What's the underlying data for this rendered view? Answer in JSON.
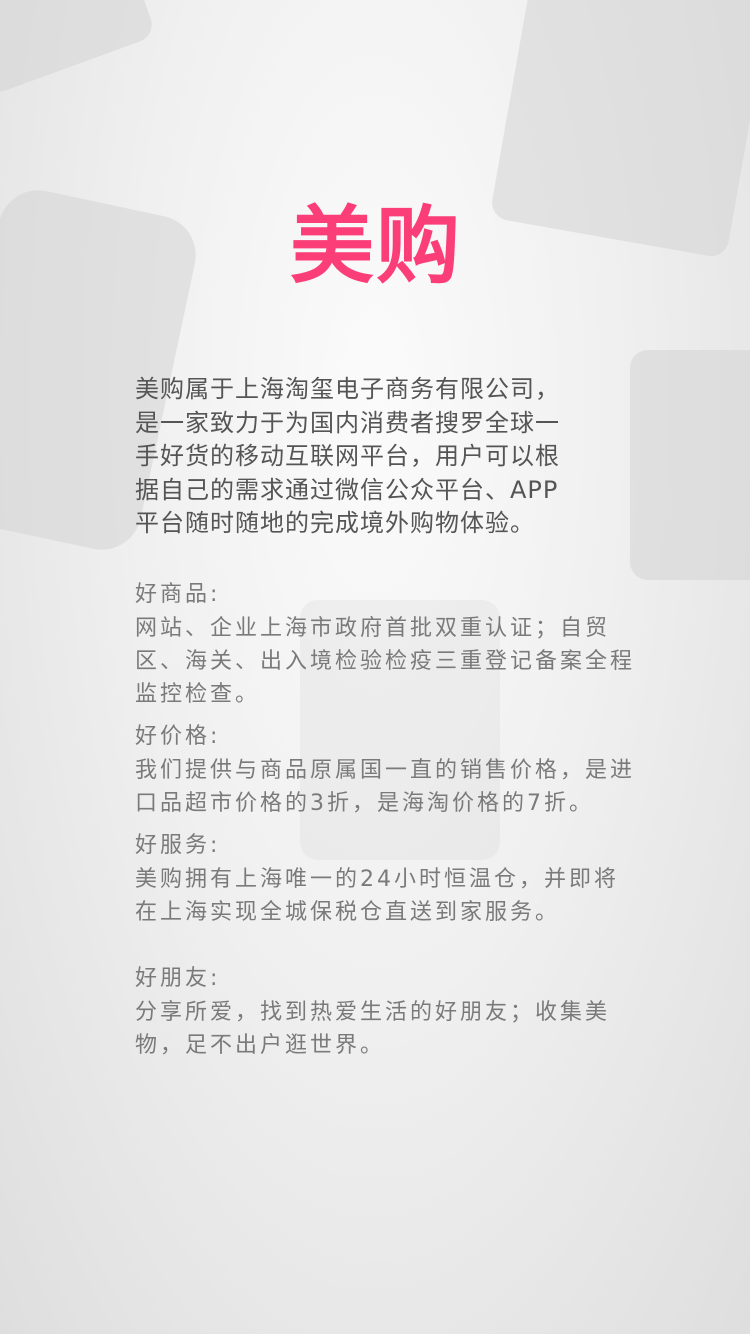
{
  "logo": "美购",
  "intro": [
    "美购属于上海淘玺电子商务有限公司，",
    "是一家致力于为国内消费者搜罗全球一",
    "手好货的移动互联网平台，用户可以根",
    "据自己的需求通过微信公众平台、APP",
    "平台随时随地的完成境外购物体验。"
  ],
  "sections": [
    {
      "title": "好商品:",
      "lines": [
        "网站、企业上海市政府首批双重认证；自贸",
        "区、海关、出入境检验检疫三重登记备案全程",
        "监控检查。"
      ]
    },
    {
      "title": "好价格:",
      "lines": [
        "我们提供与商品原属国一直的销售价格，是进",
        "口品超市价格的3折，是海淘价格的7折。"
      ]
    },
    {
      "title": "好服务:",
      "lines": [
        "美购拥有上海唯一的24小时恒温仓，并即将",
        "在上海实现全城保税仓直送到家服务。"
      ]
    },
    {
      "title": "好朋友:",
      "lines": [
        "分享所爱，找到热爱生活的好朋友；收集美",
        "物，足不出户逛世界。"
      ]
    }
  ],
  "colors": {
    "brand": "#fb3e78"
  }
}
